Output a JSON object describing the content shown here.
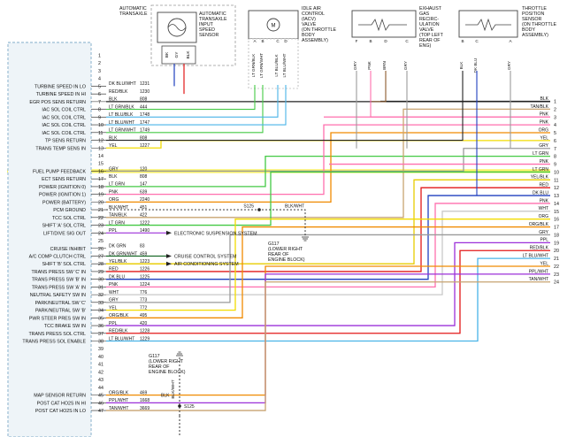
{
  "components": {
    "transaxle_title": [
      "AUTOMATIC",
      "TRANSAXLE"
    ],
    "speed_sensor": [
      "AUTOMATIC",
      "TRANSAXLE",
      "INPUT",
      "SPEED",
      "SENSOR"
    ],
    "speed_sensor_pins": [
      "BK",
      "GY",
      "BLK"
    ],
    "iac_valve": [
      "IDLE AIR",
      "CONTROL",
      "(IACV)",
      "VALVE",
      "(ON THROTTLE",
      "BODY",
      "ASSEMBLY)"
    ],
    "iac_pins": [
      "LT GRN/BLK",
      "LT GRN/WHT",
      "LT BLU/BLK",
      "LT BLU/WHT"
    ],
    "egr_valve": [
      "EXHAUST",
      "GAS",
      "RECIRC-",
      "ULATION",
      "VALVE",
      "(TOP LEFT",
      "REAR OF",
      "ENG)"
    ],
    "egr_pins": [
      "GRY",
      "PNK",
      "BRN",
      "GRY"
    ],
    "tps_sensor": [
      "THROTTLE",
      "POSITION",
      "SENSOR",
      "(ON THROTTLE",
      "BODY",
      "ASSEMBLY)"
    ],
    "tps_pins": [
      "BLK",
      "DK BLU",
      "GRY"
    ],
    "pin_letters": [
      "A",
      "B",
      "C",
      "D",
      "E",
      "F"
    ]
  },
  "pcm_pins": [
    {
      "n": "1",
      "label": "",
      "wire": "",
      "circuit": ""
    },
    {
      "n": "2",
      "label": "",
      "wire": "",
      "circuit": ""
    },
    {
      "n": "3",
      "label": "",
      "wire": "",
      "circuit": ""
    },
    {
      "n": "4",
      "label": "",
      "wire": "",
      "circuit": ""
    },
    {
      "n": "5",
      "label": "TURBINE SPEED IN LO",
      "wire": "DK BLU/WHT",
      "circuit": "1231"
    },
    {
      "n": "6",
      "label": "TURBINE SPEED IN HI",
      "wire": "RED/BLK",
      "circuit": "1230"
    },
    {
      "n": "7",
      "label": "EGR POS SENS RETURN",
      "wire": "BLK",
      "circuit": "808"
    },
    {
      "n": "8",
      "label": "IAC SOL COIL CTRL",
      "wire": "LT GRN/BLK",
      "circuit": "444"
    },
    {
      "n": "9",
      "label": "IAC SOL COIL CTRL",
      "wire": "LT BLU/BLK",
      "circuit": "1748"
    },
    {
      "n": "10",
      "label": "IAC SOL COIL CTRL",
      "wire": "LT BLU/WHT",
      "circuit": "1747"
    },
    {
      "n": "11",
      "label": "IAC SOL COIL CTRL",
      "wire": "LT GRN/WHT",
      "circuit": "1749"
    },
    {
      "n": "12",
      "label": "TP SENS RETURN",
      "wire": "BLK",
      "circuit": "808"
    },
    {
      "n": "13",
      "label": "TRANS TEMP SENS IN",
      "wire": "YEL",
      "circuit": "1227"
    },
    {
      "n": "14",
      "label": "",
      "wire": "",
      "circuit": ""
    },
    {
      "n": "15",
      "label": "",
      "wire": "",
      "circuit": ""
    },
    {
      "n": "16",
      "label": "FUEL PUMP FEEDBACK",
      "wire": "GRY",
      "circuit": "120"
    },
    {
      "n": "17",
      "label": "ECT SENS RETURN",
      "wire": "BLK",
      "circuit": "808"
    },
    {
      "n": "18",
      "label": "POWER (IGNITION 0)",
      "wire": "LT GRN",
      "circuit": "147"
    },
    {
      "n": "19",
      "label": "POWER (IGNITION 1)",
      "wire": "PNK",
      "circuit": "639"
    },
    {
      "n": "20",
      "label": "POWER (BATTERY)",
      "wire": "ORG",
      "circuit": "2240"
    },
    {
      "n": "21",
      "label": "PCM GROUND",
      "wire": "BLK/WHT",
      "circuit": "451"
    },
    {
      "n": "22",
      "label": "TCC SOL CTRL",
      "wire": "TAN/BLK",
      "circuit": "422"
    },
    {
      "n": "23",
      "label": "SHIFT 'A' SOL CTRL",
      "wire": "LT GRN",
      "circuit": "1222"
    },
    {
      "n": "24",
      "label": "LIFT/DIVE SIG OUT",
      "wire": "PPL",
      "circuit": "1490"
    },
    {
      "n": "25",
      "label": "",
      "wire": "",
      "circuit": ""
    },
    {
      "n": "26",
      "label": "CRUISE INHIBIT",
      "wire": "DK GRN",
      "circuit": "83"
    },
    {
      "n": "27",
      "label": "A/C COMP CLUTCH CTRL",
      "wire": "DK GRN/WHT",
      "circuit": "459"
    },
    {
      "n": "28",
      "label": "SHIFT 'B' SOL CTRL",
      "wire": "YEL/BLK",
      "circuit": "1223"
    },
    {
      "n": "29",
      "label": "TRANS PRESS SW 'C' IN",
      "wire": "RED",
      "circuit": "1226"
    },
    {
      "n": "30",
      "label": "TRANS PRESS SW 'B' IN",
      "wire": "DK BLU",
      "circuit": "1225"
    },
    {
      "n": "31",
      "label": "TRANS PRESS SW 'A' IN",
      "wire": "PNK",
      "circuit": "1224"
    },
    {
      "n": "32",
      "label": "NEUTRAL SAFETY SW IN",
      "wire": "WHT",
      "circuit": "776"
    },
    {
      "n": "33",
      "label": "PARK/NEUTRAL SW 'C'",
      "wire": "GRY",
      "circuit": "773"
    },
    {
      "n": "34",
      "label": "PARK/NEUTRAL SW 'B'",
      "wire": "YEL",
      "circuit": "772"
    },
    {
      "n": "35",
      "label": "PWR STEER PRES SW IN",
      "wire": "ORG/BLK",
      "circuit": "495"
    },
    {
      "n": "36",
      "label": "TCC BRAKE SW IN",
      "wire": "PPL",
      "circuit": "420"
    },
    {
      "n": "37",
      "label": "TRANS PRESS SOL CTRL",
      "wire": "RED/BLK",
      "circuit": "1228"
    },
    {
      "n": "38",
      "label": "TRANS PRESS SOL ENABLE",
      "wire": "LT BLU/WHT",
      "circuit": "1229"
    },
    {
      "n": "39",
      "label": "",
      "wire": "",
      "circuit": ""
    },
    {
      "n": "40",
      "label": "",
      "wire": "",
      "circuit": ""
    },
    {
      "n": "41",
      "label": "",
      "wire": "",
      "circuit": ""
    },
    {
      "n": "42",
      "label": "",
      "wire": "",
      "circuit": ""
    },
    {
      "n": "43",
      "label": "",
      "wire": "",
      "circuit": ""
    },
    {
      "n": "44",
      "label": "",
      "wire": "",
      "circuit": ""
    },
    {
      "n": "45",
      "label": "MAP SENSOR RETURN",
      "wire": "ORG/BLK",
      "circuit": "469"
    },
    {
      "n": "46",
      "label": "POST CAT HO2S IN HI",
      "wire": "PPL/WHT",
      "circuit": "1668"
    },
    {
      "n": "47",
      "label": "POST CAT HO2S IN LO",
      "wire": "TAN/WHT",
      "circuit": "3669"
    }
  ],
  "right_connector": [
    {
      "n": "1",
      "wire": "BLK"
    },
    {
      "n": "2",
      "wire": "TAN/BLK"
    },
    {
      "n": "3",
      "wire": "PNK"
    },
    {
      "n": "4",
      "wire": "PNK"
    },
    {
      "n": "5",
      "wire": "ORG"
    },
    {
      "n": "6",
      "wire": "YEL"
    },
    {
      "n": "7",
      "wire": "GRY"
    },
    {
      "n": "8",
      "wire": "LT GRN"
    },
    {
      "n": "9",
      "wire": "PNK"
    },
    {
      "n": "10",
      "wire": "LT GRN"
    },
    {
      "n": "11",
      "wire": "YEL/BLK"
    },
    {
      "n": "12",
      "wire": "RED"
    },
    {
      "n": "13",
      "wire": "DK BLU"
    },
    {
      "n": "14",
      "wire": "PNK"
    },
    {
      "n": "15",
      "wire": "WHT"
    },
    {
      "n": "16",
      "wire": "ORG"
    },
    {
      "n": "17",
      "wire": "ORG/BLK"
    },
    {
      "n": "18",
      "wire": "GRY"
    },
    {
      "n": "19",
      "wire": "PPL"
    },
    {
      "n": "20",
      "wire": "RED/BLK"
    },
    {
      "n": "21",
      "wire": "LT BLU/WHT"
    },
    {
      "n": "22",
      "wire": "YEL"
    },
    {
      "n": "23",
      "wire": "PPL/WHT"
    },
    {
      "n": "24",
      "wire": "TAN/WHT"
    }
  ],
  "systems": {
    "electronic_suspension": "ELECTRONIC SUSPENSION SYSTEM",
    "cruise_control": "CRUISE CONTROL SYSTEM",
    "air_conditioning": "AIR CONDITIONING SYSTEM"
  },
  "splices": {
    "s125_top": "S125",
    "s125_top_wire": "BLK/WHT",
    "g117_top": [
      "G117",
      "(LOWER RIGHT",
      "REAR OF",
      "ENGINE BLOCK)"
    ],
    "g117_bottom": [
      "G117",
      "(LOWER RIGHT",
      "REAR OF",
      "ENGINE BLOCK)"
    ],
    "g117_bottom_wire": "BLK/WHT",
    "s125_bottom": "S125",
    "blk_tag": "BLK"
  },
  "wire_colors": {
    "BLK": "#222222",
    "BLK/WHT": "#333333",
    "BRN": "#8b5a2b",
    "DK BLU": "#1f3fbf",
    "DK BLU/WHT": "#1f3fbf",
    "DK GRN": "#1b6b2a",
    "DK GRN/WHT": "#1b6b2a",
    "GRY": "#9a9a9a",
    "LT BLU/BLK": "#49b3e8",
    "LT BLU/WHT": "#49b3e8",
    "LT GRN": "#43c944",
    "LT GRN/BLK": "#43c944",
    "LT GRN/WHT": "#43c944",
    "ORG": "#f08a00",
    "ORG/BLK": "#f08a00",
    "PNK": "#ff6fae",
    "PPL": "#9b30d9",
    "PPL/WHT": "#9b30d9",
    "RED": "#e21818",
    "RED/BLK": "#e21818",
    "TAN/BLK": "#c8a470",
    "TAN/WHT": "#c8a470",
    "WHT": "#c9c9c9",
    "YEL": "#f2dc00",
    "YEL/BLK": "#e8cc00"
  },
  "highlight_color": "#fbf36a",
  "pcm_box_color": "#a9c6da"
}
